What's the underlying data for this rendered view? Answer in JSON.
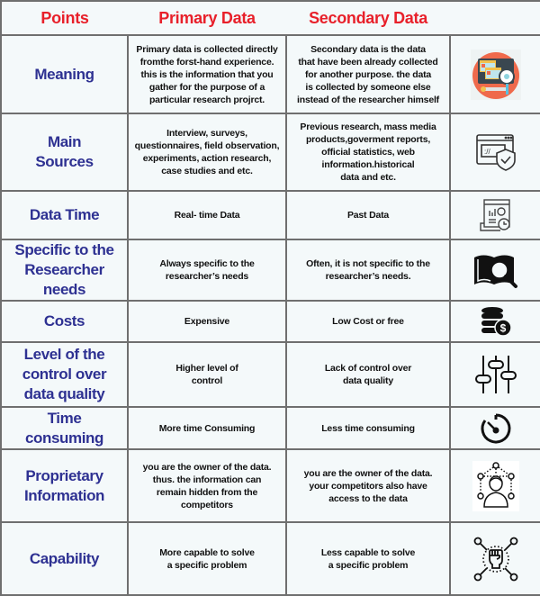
{
  "header": {
    "points": "Points",
    "primary": "Primary Data",
    "secondary": "Secondary Data"
  },
  "colors": {
    "header_text": "#e8202a",
    "point_text": "#2e3192",
    "body_text": "#111111",
    "background": "#f4f9fa",
    "border": "#6f6f6f"
  },
  "rows": [
    {
      "point": "Meaning",
      "primary": "Primary data is collected directly\nfromthe forst-hand experience.\nthis is the information that you\ngather for the purpose of a\nparticular research projrct.",
      "secondary": "Secondary data is the data\nthat have been already collected\nfor another purpose. the data\nis collected by someone else\ninstead of the researcher himself",
      "icon": "monitor-bug-search-icon"
    },
    {
      "point": "Main\nSources",
      "primary": "Interview, surveys,\nquestionnaires, field observation,\nexperiments, action research,\ncase studies and etc.",
      "secondary": "Previous research, mass media\nproducts,goverment reports,\nofficial statistics, web\ninformation.historical\ndata and etc.",
      "icon": "browser-shield-icon"
    },
    {
      "point": "Data Time",
      "primary": "Real- time Data",
      "secondary": "Past Data",
      "icon": "report-clock-icon"
    },
    {
      "point": "Specific to the\nResearcher needs",
      "primary": "Always specific to the\nresearcher’s needs",
      "secondary": "Often, it is not specific to the\nresearcher’s needs.",
      "icon": "book-magnifier-icon"
    },
    {
      "point": "Costs",
      "primary": "Expensive",
      "secondary": "Low Cost or free",
      "icon": "coins-dollar-icon"
    },
    {
      "point": "Level of the\ncontrol over\ndata quality",
      "primary": "Higher level of\ncontrol",
      "secondary": "Lack of control over\ndata quality",
      "icon": "sliders-icon"
    },
    {
      "point": "Time\nconsuming",
      "primary": "More time Consuming",
      "secondary": "Less time consuming",
      "icon": "timer-icon"
    },
    {
      "point": "Proprietary\nInformation",
      "primary": "you are the owner of the data.\nthus. the information can\nremain hidden from the\ncompetitors",
      "secondary": "you are the owner of the data.\nyour competitors also have\naccess to the data",
      "icon": "person-network-icon"
    },
    {
      "point": "Capability",
      "primary": "More capable to solve\na specific problem",
      "secondary": "Less capable to solve\na specific problem",
      "icon": "fist-network-icon"
    }
  ]
}
